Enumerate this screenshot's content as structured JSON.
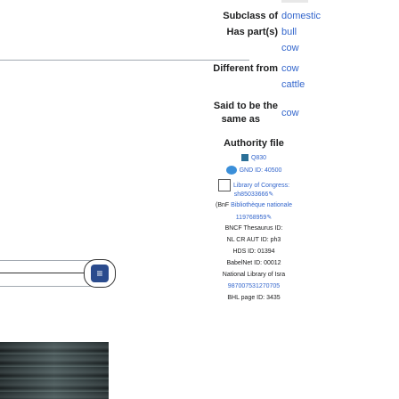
{
  "infobox": {
    "subclass_label": "Subclass of",
    "subclass_value": "domestic",
    "has_parts_label": "Has part(s)",
    "has_parts_values": [
      "bull",
      "cow"
    ],
    "different_from_label": "Different from",
    "different_from_values": [
      "cow",
      "cattle"
    ],
    "said_same_label_1": "Said to be the",
    "said_same_label_2": "same as",
    "said_same_value": "cow",
    "authority_heading": "Authority file",
    "authority": {
      "wikidata": "Q830",
      "gnd": "GND ID: 40500",
      "loc_label": "Library of Congress:",
      "loc_id": "sh85033666",
      "bnf_prefix": "(BnF",
      "bnf_label": "Bibliothèque nationale",
      "bnf_id": "119768959",
      "bncf": "BNCF Thesaurus ID:",
      "nlcr": "NL CR AUT ID: ph3",
      "hds": "HDS ID: 01394",
      "babelnet": "BabelNet ID: 00012",
      "nli_label": "National Library of Isra",
      "nli_id": "987007531270705",
      "bhl": "BHL page ID: 3435"
    }
  },
  "colors": {
    "link": "#3366cc",
    "border": "#a2a9b1",
    "text": "#202122"
  },
  "icons": [
    "wikidata-barcode-icon",
    "gnd-icon",
    "library-of-congress-icon",
    "edit-pencil-icon"
  ]
}
